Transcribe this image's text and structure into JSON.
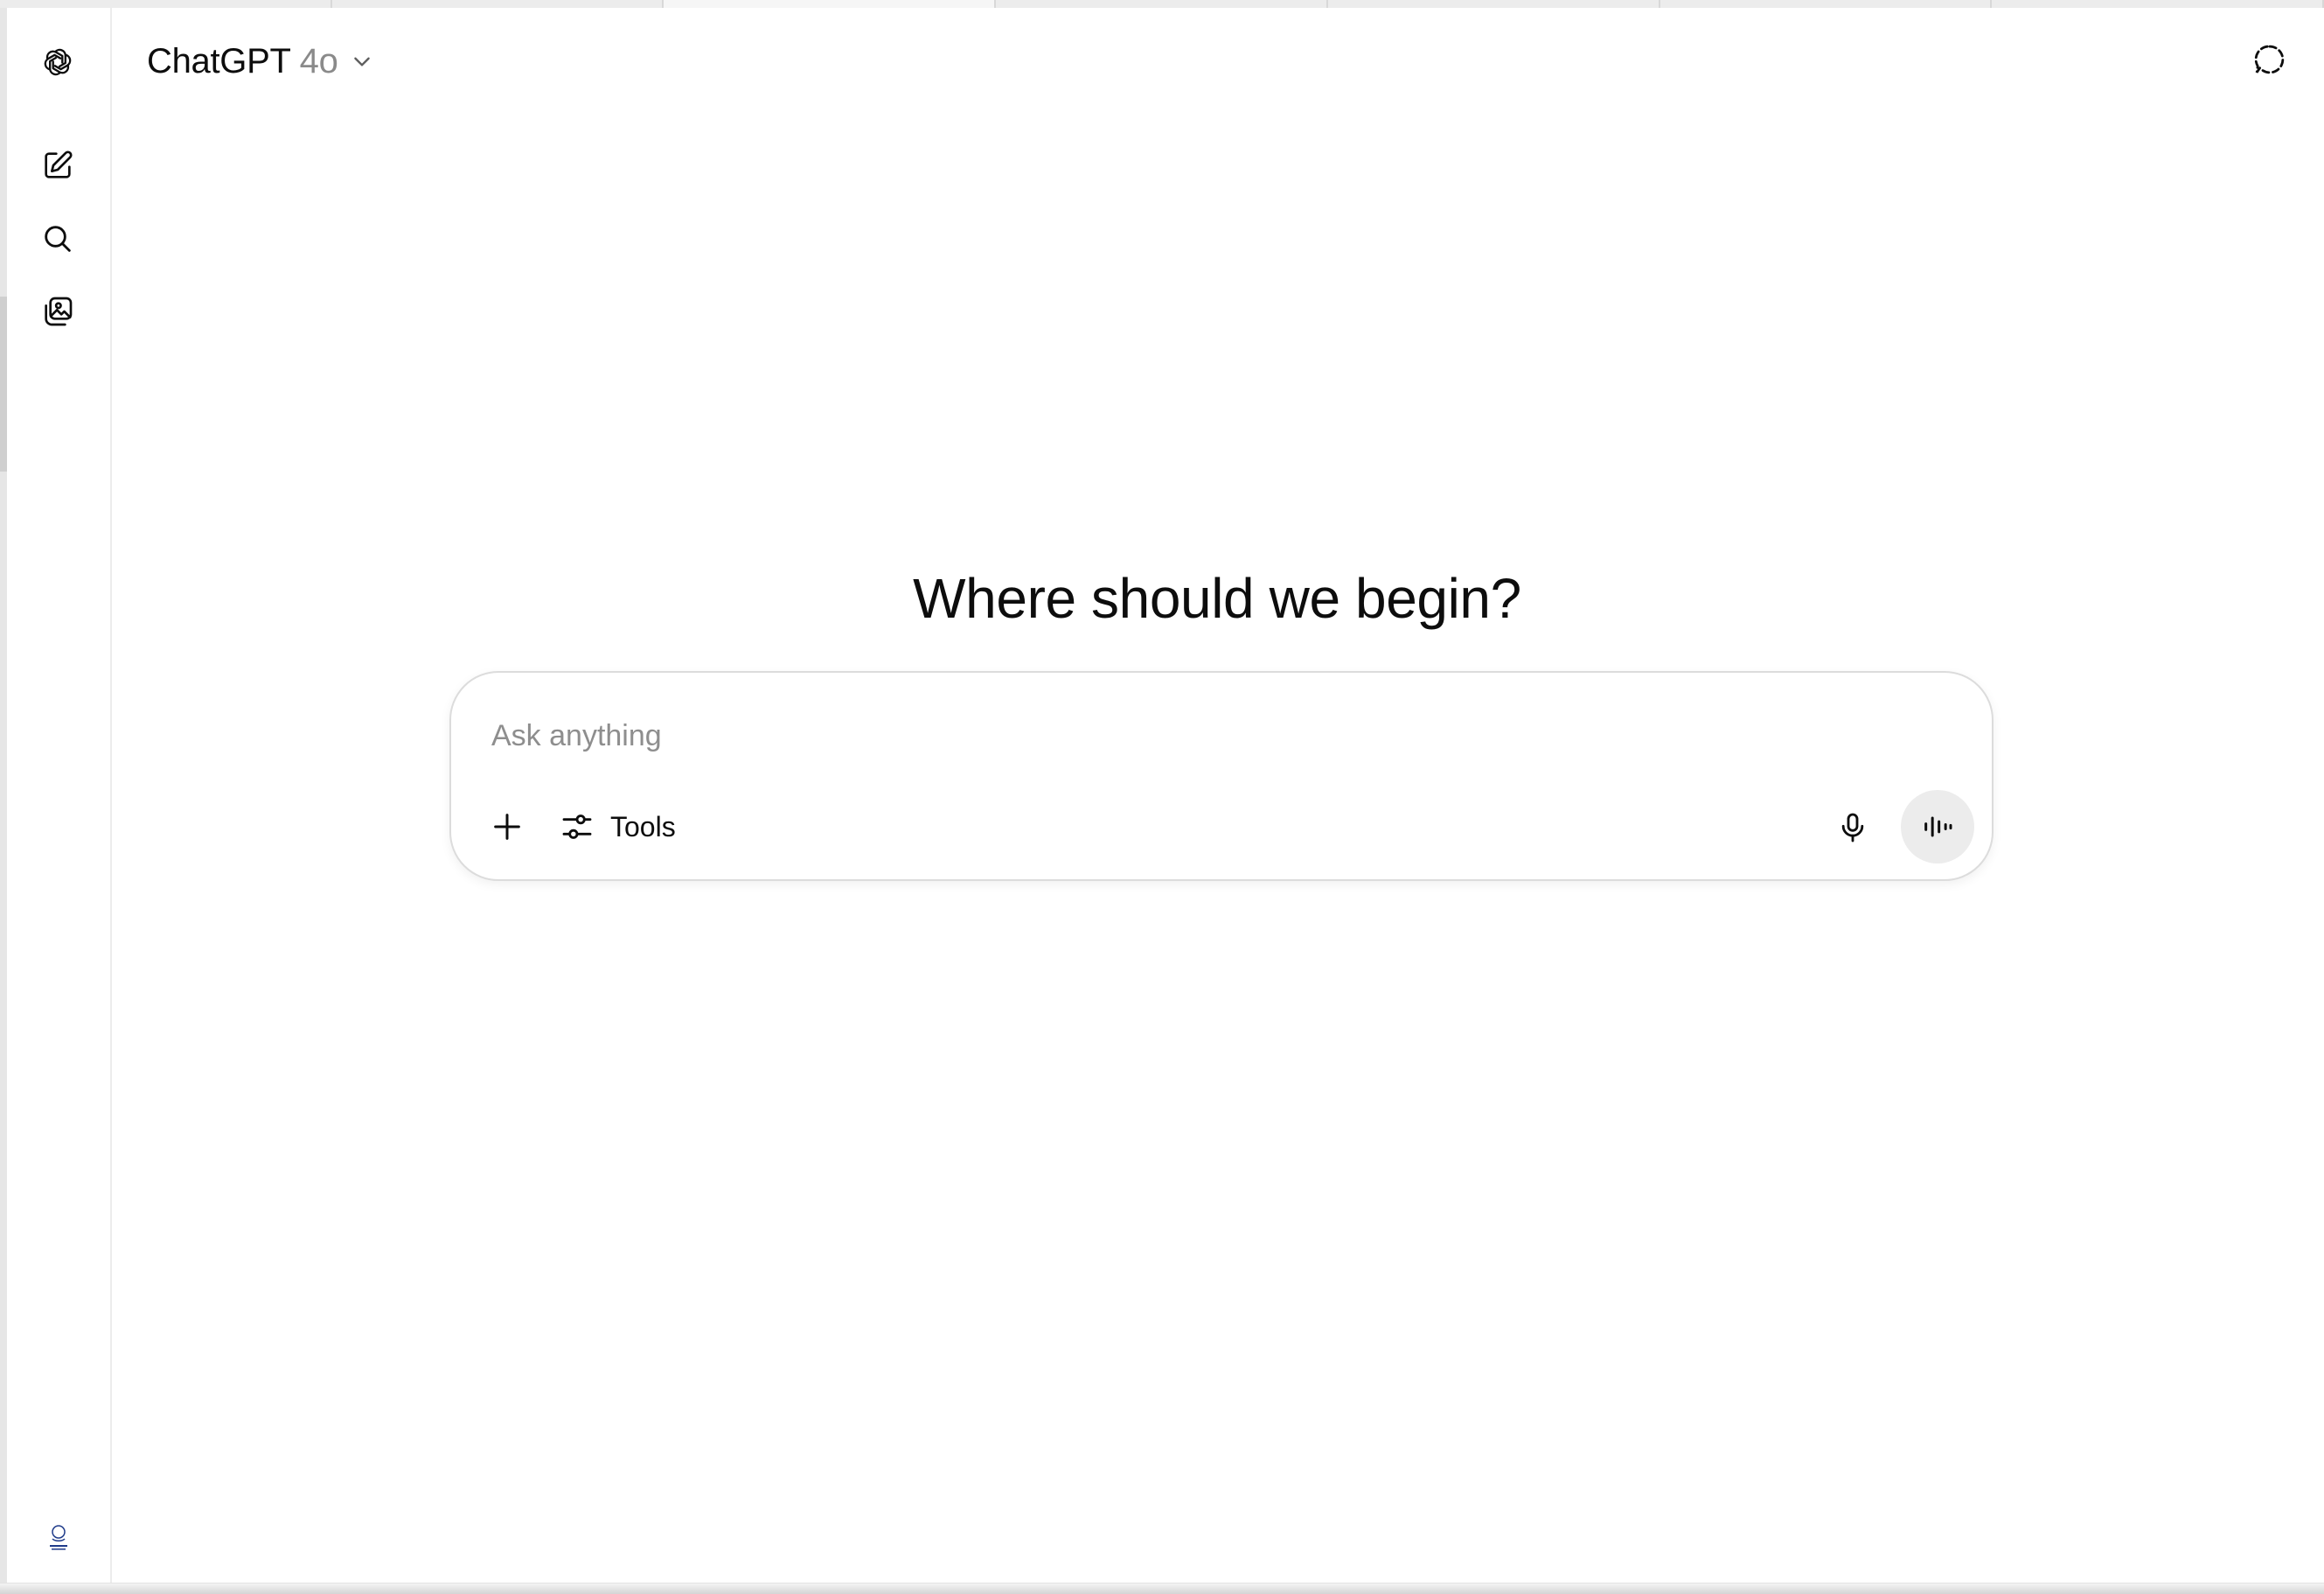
{
  "header": {
    "brand": "ChatGPT",
    "model_version": "4o"
  },
  "sidebar": {
    "items": [
      {
        "icon": "new-chat-icon"
      },
      {
        "icon": "search-icon"
      },
      {
        "icon": "library-icon"
      }
    ],
    "avatar": {
      "icon": "profile-avatar"
    }
  },
  "main": {
    "title": "Where should we begin?"
  },
  "composer": {
    "placeholder": "Ask anything",
    "value": "",
    "tools_label": "Tools"
  },
  "colors": {
    "text": "#0d0d0d",
    "muted": "#8a8a8a",
    "border": "#dcdcdc",
    "voice_button_bg": "#ececec",
    "background": "#ffffff"
  }
}
